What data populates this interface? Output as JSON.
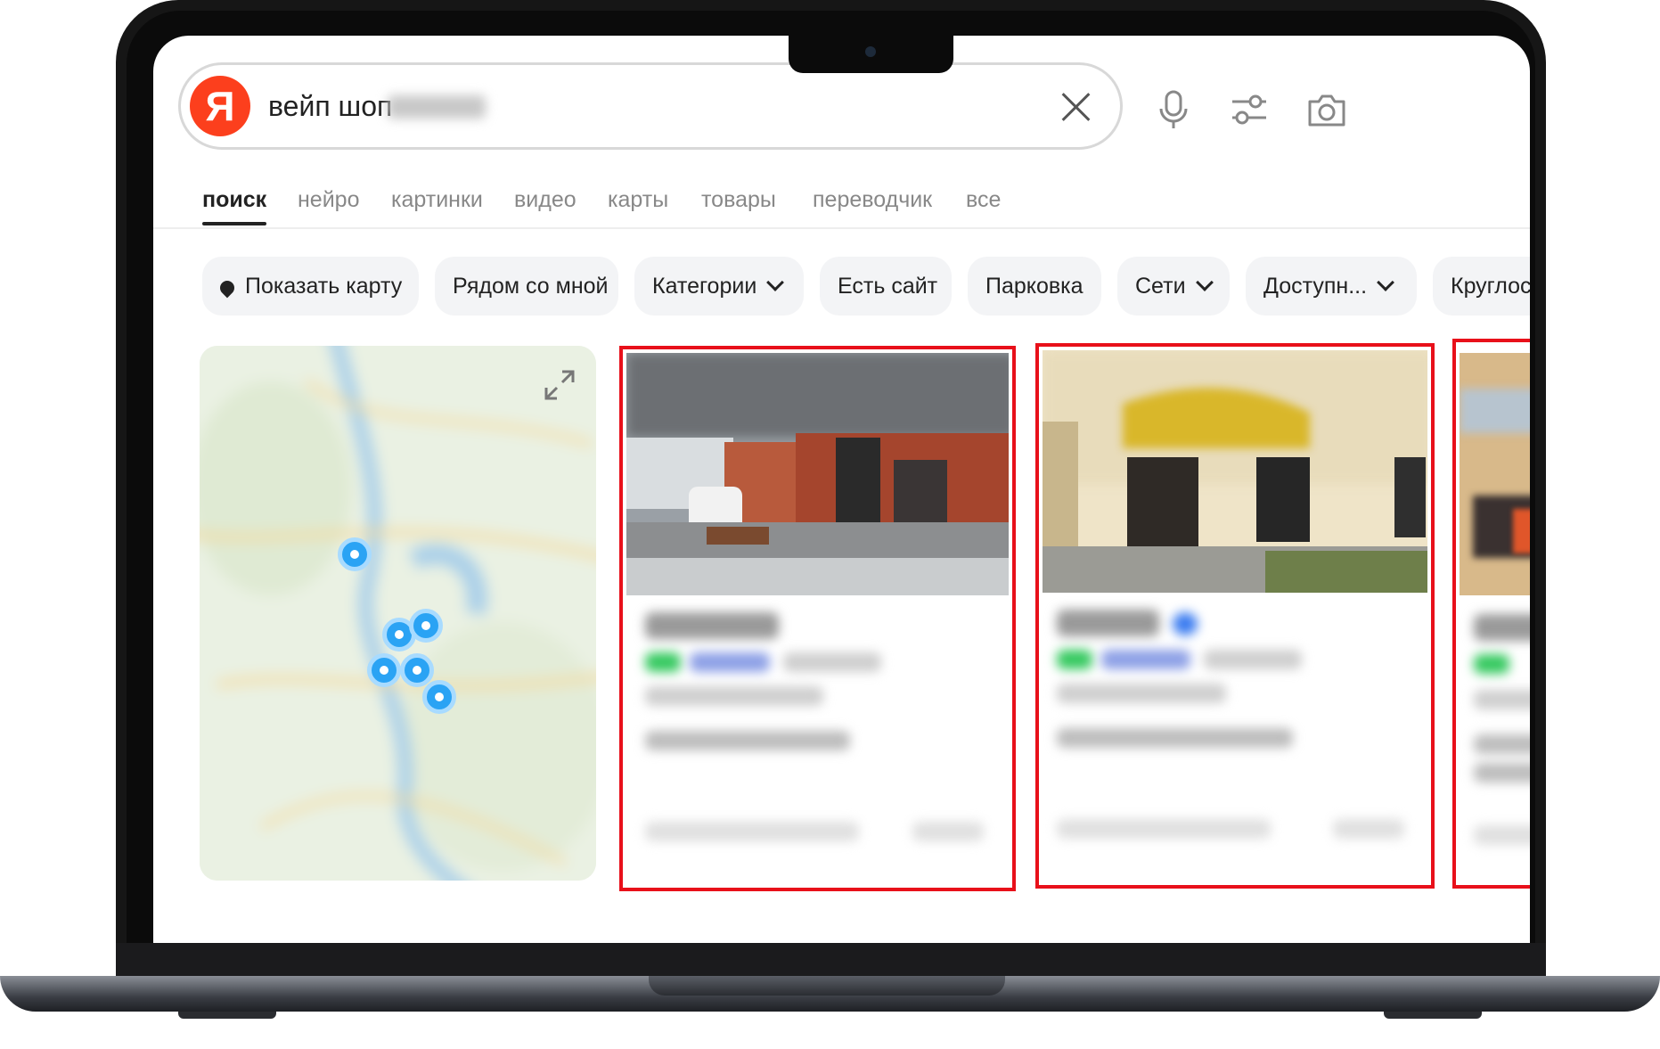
{
  "search": {
    "logo_letter": "Я",
    "query": "вейп шоп"
  },
  "icons": {
    "mic": "microphone-icon",
    "filters": "filters-icon",
    "camera": "camera-icon",
    "clear": "close-icon"
  },
  "tabs": [
    {
      "label": "поиск",
      "active": true
    },
    {
      "label": "нейро"
    },
    {
      "label": "картинки"
    },
    {
      "label": "видео"
    },
    {
      "label": "карты"
    },
    {
      "label": "товары"
    },
    {
      "label": "переводчик"
    },
    {
      "label": "все"
    }
  ],
  "chips": [
    {
      "label": "Показать карту"
    },
    {
      "label": "Рядом со мной"
    },
    {
      "label": "Категории"
    },
    {
      "label": "Есть сайт"
    },
    {
      "label": "Парковка"
    },
    {
      "label": "Сети"
    },
    {
      "label": "Доступн..."
    },
    {
      "label": "Круглосу"
    }
  ],
  "colors": {
    "brand": "#fc3f1d",
    "highlight": "#e8101a",
    "pin": "#2aa3f4"
  }
}
